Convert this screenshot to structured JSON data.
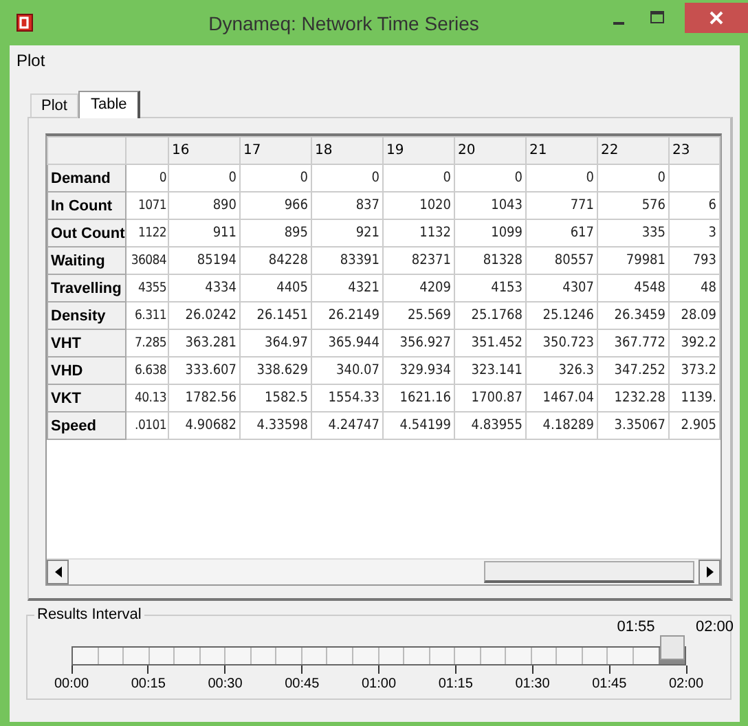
{
  "window": {
    "title": "Dynameq: Network Time Series"
  },
  "menu": [
    "Plot"
  ],
  "tabs": [
    {
      "label": "Plot",
      "selected": false
    },
    {
      "label": "Table",
      "selected": true
    }
  ],
  "table": {
    "columns": [
      null,
      "16",
      "17",
      "18",
      "19",
      "20",
      "21",
      "22",
      "23"
    ],
    "rows": [
      {
        "label": "Demand",
        "cells": [
          "0",
          "0",
          "0",
          "0",
          "0",
          "0",
          "0",
          "0",
          null
        ]
      },
      {
        "label": "In Count",
        "cells": [
          "1071",
          "890",
          "966",
          "837",
          "1020",
          "1043",
          "771",
          "576",
          "6"
        ]
      },
      {
        "label": "Out Count",
        "cells": [
          "1122",
          "911",
          "895",
          "921",
          "1132",
          "1099",
          "617",
          "335",
          "3"
        ]
      },
      {
        "label": "Waiting",
        "cells": [
          "36084",
          "85194",
          "84228",
          "83391",
          "82371",
          "81328",
          "80557",
          "79981",
          "793"
        ]
      },
      {
        "label": "Travelling",
        "cells": [
          "4355",
          "4334",
          "4405",
          "4321",
          "4209",
          "4153",
          "4307",
          "4548",
          "48"
        ]
      },
      {
        "label": "Density",
        "cells": [
          "6.311",
          "26.0242",
          "26.1451",
          "26.2149",
          "25.569",
          "25.1768",
          "25.1246",
          "26.3459",
          "28.09"
        ]
      },
      {
        "label": "VHT",
        "cells": [
          "7.285",
          "363.281",
          "364.97",
          "365.944",
          "356.927",
          "351.452",
          "350.723",
          "367.772",
          "392.2"
        ]
      },
      {
        "label": "VHD",
        "cells": [
          "6.638",
          "333.607",
          "338.629",
          "340.07",
          "329.934",
          "323.141",
          "326.3",
          "347.252",
          "373.2"
        ]
      },
      {
        "label": "VKT",
        "cells": [
          "40.13",
          "1782.56",
          "1582.5",
          "1554.33",
          "1621.16",
          "1700.87",
          "1467.04",
          "1232.28",
          "1139."
        ]
      },
      {
        "label": "Speed",
        "cells": [
          ".0101",
          "4.90682",
          "4.33598",
          "4.24747",
          "4.54199",
          "4.83955",
          "4.18289",
          "3.35067",
          "2.905"
        ]
      }
    ]
  },
  "results_interval": {
    "title": "Results Interval",
    "level": 0.958,
    "current": "01:55",
    "max": "02:00",
    "ticks": [
      "00:00",
      "00:15",
      "00:30",
      "00:45",
      "01:00",
      "01:15",
      "01:30",
      "01:45",
      "02:00"
    ]
  }
}
